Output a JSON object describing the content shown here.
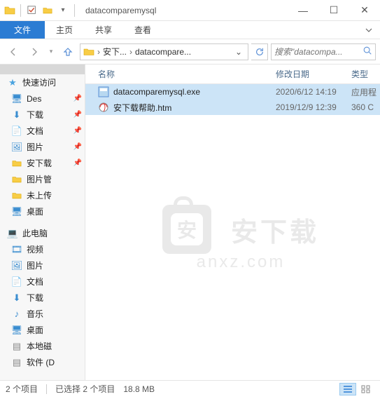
{
  "title": "datacomparemysql",
  "ribbon": {
    "file": "文件",
    "home": "主页",
    "share": "共享",
    "view": "查看"
  },
  "breadcrumb": {
    "item1": "安下...",
    "item2": "datacompare..."
  },
  "search": {
    "placeholder": "搜索\"datacompa..."
  },
  "columns": {
    "name": "名称",
    "date": "修改日期",
    "type": "类型"
  },
  "sidebar": {
    "quick": "快速访问",
    "items": [
      {
        "label": "Des"
      },
      {
        "label": "下载"
      },
      {
        "label": "文档"
      },
      {
        "label": "图片"
      },
      {
        "label": "安下载"
      },
      {
        "label": "图片管"
      },
      {
        "label": "未上传"
      },
      {
        "label": "桌面"
      }
    ],
    "pc": "此电脑",
    "pc_items": [
      {
        "label": "视频"
      },
      {
        "label": "图片"
      },
      {
        "label": "文档"
      },
      {
        "label": "下载"
      },
      {
        "label": "音乐"
      },
      {
        "label": "桌面"
      },
      {
        "label": "本地磁"
      },
      {
        "label": "软件 (D"
      }
    ]
  },
  "files": [
    {
      "name": "datacomparemysql.exe",
      "date": "2020/6/12 14:19",
      "type": "应用程"
    },
    {
      "name": "安下载帮助.htm",
      "date": "2019/12/9 12:39",
      "type": "360 C"
    }
  ],
  "status": {
    "count": "2 个项目",
    "selection": "已选择 2 个项目",
    "size": "18.8 MB"
  },
  "watermark": {
    "cn": "安下载",
    "en": "anxz.com"
  }
}
